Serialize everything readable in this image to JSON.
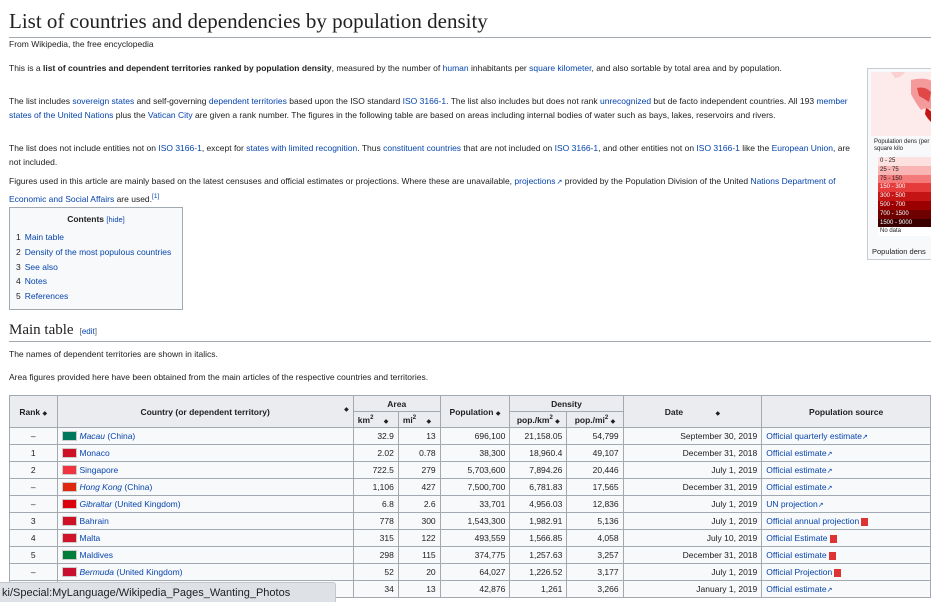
{
  "page": {
    "title": "List of countries and dependencies by population density",
    "tagline": "From Wikipedia, the free encyclopedia"
  },
  "intro": {
    "p1": [
      "This is a ",
      "list of countries and dependent territories ranked by population density",
      ", measured by the number of ",
      "human",
      " inhabitants per ",
      "square kilometer",
      ", and also sortable by total area and by population."
    ],
    "p2": [
      "The list includes ",
      "sovereign states",
      " and self-governing ",
      "dependent territories",
      " based upon the ISO standard ",
      "ISO 3166-1",
      ". The list also includes but does not rank ",
      "unrecognized",
      " but de facto independent countries. All 193 ",
      "member states of the United Nations",
      " plus the ",
      "Vatican City",
      " are given a rank number. The figures in the following table are based on areas including internal bodies of water such as bays, lakes, reservoirs and rivers."
    ],
    "p3": [
      "The list does not include entities not on ",
      "ISO 3166-1",
      ", except for ",
      "states with limited recognition",
      ". Thus ",
      "constituent countries",
      " that are not included on ",
      "ISO 3166-1",
      ", and other entities not on ",
      "ISO 3166-1",
      " like the ",
      "European Union",
      ", are not included."
    ],
    "p4": [
      "Figures used in this article are mainly based on the latest censuses and official estimates or projections. Where these are unavailable, ",
      "projections",
      " provided by the Population Division of the United ",
      "Nations Department of Economic and Social Affairs",
      " are used.",
      "[1]"
    ]
  },
  "toc": {
    "title": "Contents",
    "hide": "[hide]",
    "items": [
      {
        "num": "1",
        "label": "Main table"
      },
      {
        "num": "2",
        "label": "Density of the most populous countries"
      },
      {
        "num": "3",
        "label": "See also"
      },
      {
        "num": "4",
        "label": "Notes"
      },
      {
        "num": "5",
        "label": "References"
      }
    ]
  },
  "section": {
    "heading": "Main table",
    "edit": "edit",
    "note1": "The names of dependent territories are shown in italics.",
    "note2": "Area figures provided here have been obtained from the main articles of the respective countries and territories."
  },
  "map": {
    "legend_title": "Population dens (per square kilo",
    "legend": [
      {
        "label": "0 - 25",
        "color": "#fde0e0"
      },
      {
        "label": "25 - 75",
        "color": "#f9b4b4"
      },
      {
        "label": "75 - 150",
        "color": "#f47a7a"
      },
      {
        "label": "150 - 300",
        "color": "#e63b3b"
      },
      {
        "label": "300 - 500",
        "color": "#c41414"
      },
      {
        "label": "500 - 700",
        "color": "#9b0000"
      },
      {
        "label": "700 - 1500",
        "color": "#6e0000"
      },
      {
        "label": "1500 - 9000",
        "color": "#3a0000"
      },
      {
        "label": "No data",
        "color": "#ffffff"
      }
    ],
    "caption": "Population dens"
  },
  "table": {
    "headers": {
      "rank": "Rank",
      "country": "Country (or dependent territory)",
      "area": "Area",
      "km2": "km",
      "mi2": "mi",
      "population": "Population",
      "density": "Density",
      "popkm": "pop./km",
      "popmi": "pop./mi",
      "date": "Date",
      "source": "Population source",
      "sup": "2"
    },
    "rows": [
      {
        "rank": "–",
        "country": "Macau",
        "suffix": " (China)",
        "italic": true,
        "flag": "#00785e",
        "km2": "32.9",
        "mi2": "13",
        "pop": "696,100",
        "dkm": "21,158.05",
        "dmi": "54,799",
        "date": "September 30, 2019",
        "src": "Official quarterly estimate",
        "srcicon": "ext"
      },
      {
        "rank": "1",
        "country": "Monaco",
        "suffix": "",
        "italic": false,
        "flag": "#ce1126",
        "km2": "2.02",
        "mi2": "0.78",
        "pop": "38,300",
        "dkm": "18,960.4",
        "dmi": "49,107",
        "date": "December 31, 2018",
        "src": "Official estimate",
        "srcicon": "ext"
      },
      {
        "rank": "2",
        "country": "Singapore",
        "suffix": "",
        "italic": false,
        "flag": "#ef3340",
        "km2": "722.5",
        "mi2": "279",
        "pop": "5,703,600",
        "dkm": "7,894.26",
        "dmi": "20,446",
        "date": "July 1, 2019",
        "src": "Official estimate",
        "srcicon": "ext"
      },
      {
        "rank": "–",
        "country": "Hong Kong",
        "suffix": " (China)",
        "italic": true,
        "flag": "#de2910",
        "km2": "1,106",
        "mi2": "427",
        "pop": "7,500,700",
        "dkm": "6,781.83",
        "dmi": "17,565",
        "date": "December 31, 2019",
        "src": "Official estimate",
        "srcicon": "ext"
      },
      {
        "rank": "–",
        "country": "Gibraltar",
        "suffix": " (United Kingdom)",
        "italic": true,
        "flag": "#da000c",
        "km2": "6.8",
        "mi2": "2.6",
        "pop": "33,701",
        "dkm": "4,956.03",
        "dmi": "12,836",
        "date": "July 1, 2019",
        "src": "UN projection",
        "srcicon": "ext"
      },
      {
        "rank": "3",
        "country": "Bahrain",
        "suffix": "",
        "italic": false,
        "flag": "#ce1126",
        "km2": "778",
        "mi2": "300",
        "pop": "1,543,300",
        "dkm": "1,982.91",
        "dmi": "5,136",
        "date": "July 1, 2019",
        "src": "Official annual projection",
        "srcicon": "pdf"
      },
      {
        "rank": "4",
        "country": "Malta",
        "suffix": "",
        "italic": false,
        "flag": "#cf142b",
        "km2": "315",
        "mi2": "122",
        "pop": "493,559",
        "dkm": "1,566.85",
        "dmi": "4,058",
        "date": "July 10, 2019",
        "src": "Official Estimate",
        "srcicon": "pdf"
      },
      {
        "rank": "5",
        "country": "Maldives",
        "suffix": "",
        "italic": false,
        "flag": "#007e3a",
        "km2": "298",
        "mi2": "115",
        "pop": "374,775",
        "dkm": "1,257.63",
        "dmi": "3,257",
        "date": "December 31, 2018",
        "src": "Official estimate",
        "srcicon": "pdf"
      },
      {
        "rank": "–",
        "country": "Bermuda",
        "suffix": " (United Kingdom)",
        "italic": true,
        "flag": "#c8102e",
        "km2": "52",
        "mi2": "20",
        "pop": "64,027",
        "dkm": "1,226.52",
        "dmi": "3,177",
        "date": "July 1, 2019",
        "src": "Official Projection",
        "srcicon": "pdf"
      },
      {
        "rank": "",
        "country": "",
        "suffix": "",
        "italic": false,
        "flag": "",
        "km2": "34",
        "mi2": "13",
        "pop": "42,876",
        "dkm": "1,261",
        "dmi": "3,266",
        "date": "January 1, 2019",
        "src": "Official estimate",
        "srcicon": "ext"
      }
    ]
  },
  "statusbar": {
    "url": "ki/Special:MyLanguage/Wikipedia_Pages_Wanting_Photos"
  }
}
